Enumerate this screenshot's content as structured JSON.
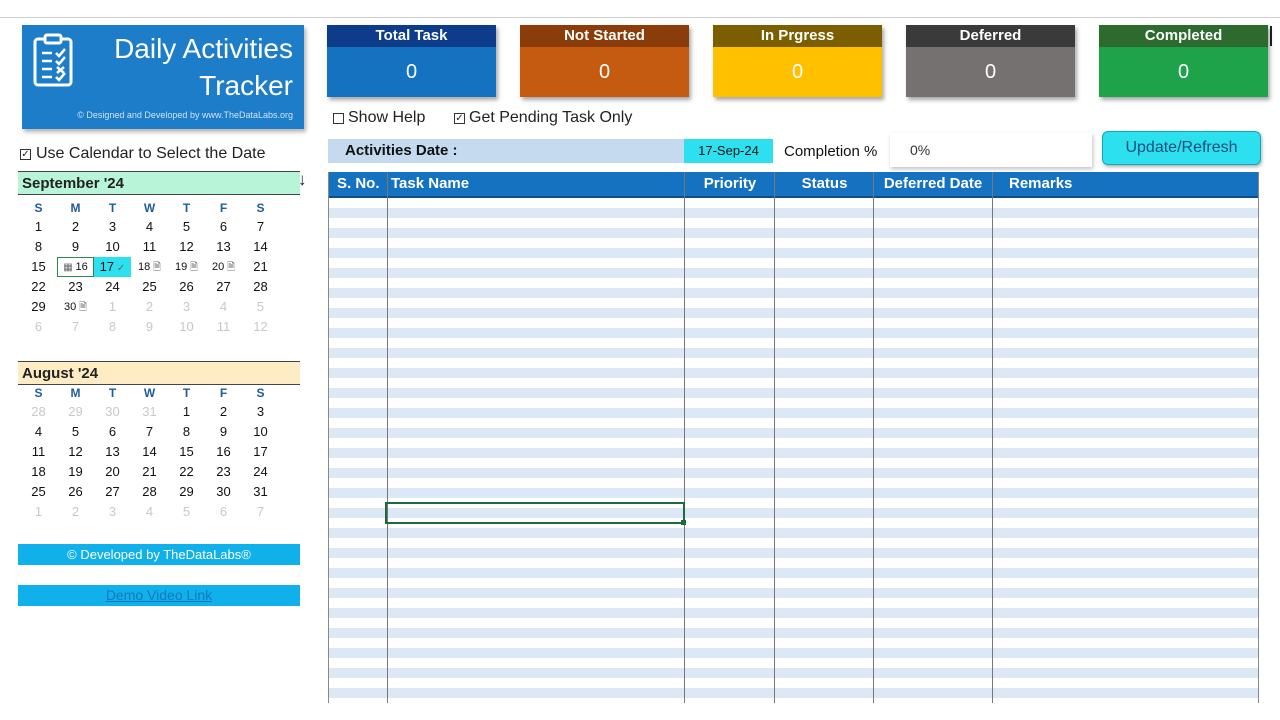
{
  "logo": {
    "title_line1": "Daily Activities",
    "title_line2": "Tracker",
    "credit": "© Designed and Developed by www.TheDataLabs.org",
    "icon": "clipboard-checklist-icon"
  },
  "kpis": [
    {
      "label": "Total Task",
      "value": "0",
      "head_color": "#0d3d8a",
      "body_color": "#1572c0"
    },
    {
      "label": "Not Started",
      "value": "0",
      "head_color": "#8a3c0a",
      "body_color": "#c55a11"
    },
    {
      "label": "In Prgress",
      "value": "0",
      "head_color": "#7a5e00",
      "body_color": "#ffc000"
    },
    {
      "label": "Deferred",
      "value": "0",
      "head_color": "#3a3a3a",
      "body_color": "#767171"
    },
    {
      "label": "Completed",
      "value": "0",
      "head_color": "#2d6a2d",
      "body_color": "#1fa34a"
    }
  ],
  "options": {
    "show_help": {
      "label": "Show Help",
      "checked": false
    },
    "pending_only": {
      "label": "Get Pending Task Only",
      "checked": true
    },
    "use_calendar": {
      "label": "Use Calendar to Select the Date",
      "checked": true
    }
  },
  "activities": {
    "label": "Activities Date :",
    "date": "17-Sep-24",
    "completion_label": "Completion %",
    "completion_value": "0%",
    "update_button": "Update/Refresh"
  },
  "table": {
    "columns": [
      "S. No.",
      "Task Name",
      "Priority",
      "Status",
      "Deferred Date",
      "Remarks"
    ],
    "rows": []
  },
  "calendar_sep": {
    "header": "September '24",
    "arrow": "↓",
    "dow": [
      "S",
      "M",
      "T",
      "W",
      "T",
      "F",
      "S"
    ],
    "weeks": [
      [
        "1",
        "2",
        "3",
        "4",
        "5",
        "6",
        "7"
      ],
      [
        "8",
        "9",
        "10",
        "11",
        "12",
        "13",
        "14"
      ],
      [
        "15",
        "16",
        "17",
        "18",
        "19",
        "20",
        "21"
      ],
      [
        "22",
        "23",
        "24",
        "25",
        "26",
        "27",
        "28"
      ],
      [
        "29",
        "30",
        "1",
        "2",
        "3",
        "4",
        "5"
      ],
      [
        "6",
        "7",
        "8",
        "9",
        "10",
        "11",
        "12"
      ]
    ],
    "selected_day": "17",
    "today_day": "16"
  },
  "calendar_aug": {
    "header": "August '24",
    "dow": [
      "S",
      "M",
      "T",
      "W",
      "T",
      "F",
      "S"
    ],
    "weeks": [
      [
        "28",
        "29",
        "30",
        "31",
        "1",
        "2",
        "3"
      ],
      [
        "4",
        "5",
        "6",
        "7",
        "8",
        "9",
        "10"
      ],
      [
        "11",
        "12",
        "13",
        "14",
        "15",
        "16",
        "17"
      ],
      [
        "18",
        "19",
        "20",
        "21",
        "22",
        "23",
        "24"
      ],
      [
        "25",
        "26",
        "27",
        "28",
        "29",
        "30",
        "31"
      ],
      [
        "1",
        "2",
        "3",
        "4",
        "5",
        "6",
        "7"
      ]
    ]
  },
  "footer": {
    "developed_by": "© Developed by TheDataLabs®",
    "demo_link": "Demo Video Link"
  }
}
